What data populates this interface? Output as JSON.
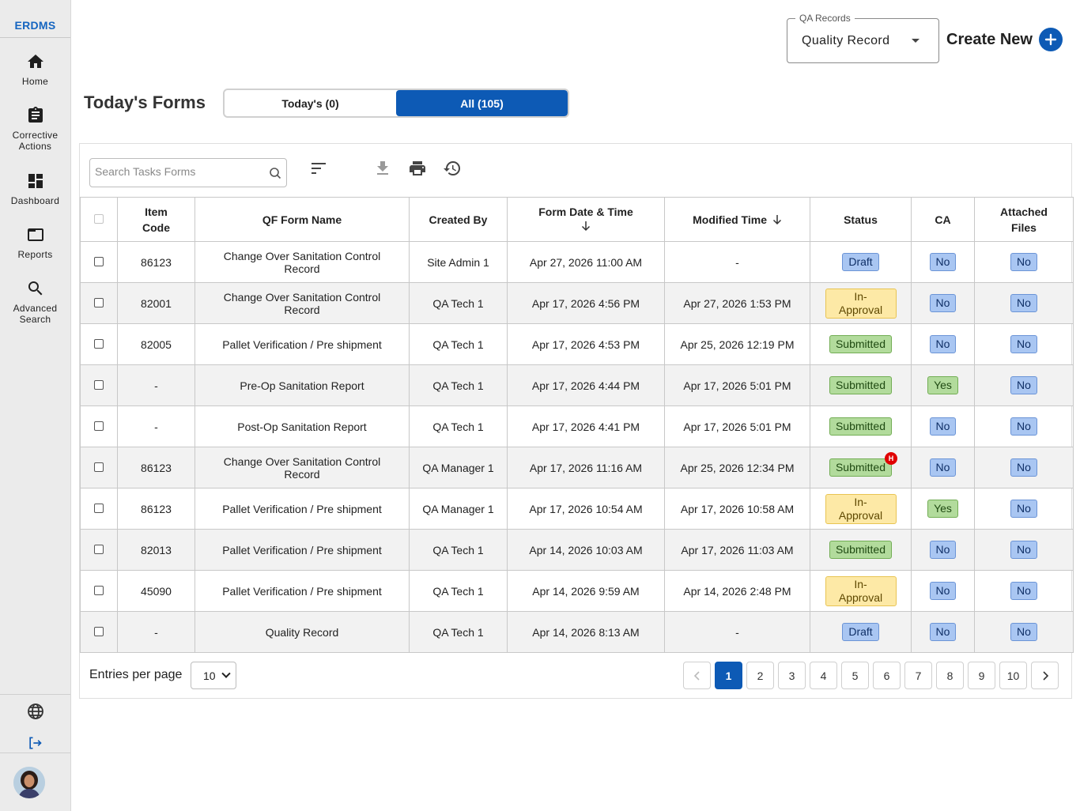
{
  "brand": "ERDMS",
  "sidebar": {
    "items": [
      {
        "label": "Home",
        "icon": "home-icon"
      },
      {
        "label": "Corrective Actions",
        "icon": "clipboard-icon"
      },
      {
        "label": "Dashboard",
        "icon": "dashboard-icon"
      },
      {
        "label": "Reports",
        "icon": "reports-icon"
      },
      {
        "label": "Advanced Search",
        "icon": "search-icon"
      }
    ],
    "bottom_icons": [
      "globe-icon",
      "logout-icon"
    ]
  },
  "header": {
    "qa_legend": "QA Records",
    "qa_value": "Quality Record",
    "create_new": "Create New"
  },
  "page_title": "Today's Forms",
  "tabs": {
    "today": "Today's (0)",
    "all": "All (105)"
  },
  "toolbar": {
    "search_placeholder": "Search Tasks Forms"
  },
  "table": {
    "columns": [
      "Item Code",
      "QF Form Name",
      "Created By",
      "Form Date & Time",
      "Modified Time",
      "Status",
      "CA",
      "Attached Files"
    ],
    "rows": [
      {
        "code": "86123",
        "name": "Change Over Sanitation Control Record",
        "by": "Site Admin 1",
        "date": "Apr 27, 2026 11:00 AM",
        "modified": "-",
        "status": "Draft",
        "ca": "No",
        "files": "No"
      },
      {
        "code": "82001",
        "name": "Change Over Sanitation Control Record",
        "by": "QA Tech 1",
        "date": "Apr 17, 2026 4:56 PM",
        "modified": "Apr 27, 2026 1:53 PM",
        "status": "In-Approval",
        "ca": "No",
        "files": "No"
      },
      {
        "code": "82005",
        "name": "Pallet Verification / Pre shipment",
        "by": "QA Tech 1",
        "date": "Apr 17, 2026 4:53 PM",
        "modified": "Apr 25, 2026 12:19 PM",
        "status": "Submitted",
        "ca": "No",
        "files": "No"
      },
      {
        "code": "-",
        "name": "Pre-Op Sanitation Report",
        "by": "QA Tech 1",
        "date": "Apr 17, 2026 4:44 PM",
        "modified": "Apr 17, 2026 5:01 PM",
        "status": "Submitted",
        "ca": "Yes",
        "files": "No"
      },
      {
        "code": "-",
        "name": "Post-Op Sanitation Report",
        "by": "QA Tech 1",
        "date": "Apr 17, 2026 4:41 PM",
        "modified": "Apr 17, 2026 5:01 PM",
        "status": "Submitted",
        "ca": "No",
        "files": "No"
      },
      {
        "code": "86123",
        "name": "Change Over Sanitation Control Record",
        "by": "QA Manager 1",
        "date": "Apr 17, 2026 11:16 AM",
        "modified": "Apr 25, 2026 12:34 PM",
        "status": "Submitted",
        "status_flag": "H",
        "ca": "No",
        "files": "No"
      },
      {
        "code": "86123",
        "name": "Pallet Verification / Pre shipment",
        "by": "QA Manager 1",
        "date": "Apr 17, 2026 10:54 AM",
        "modified": "Apr 17, 2026 10:58 AM",
        "status": "In-Approval",
        "ca": "Yes",
        "files": "No"
      },
      {
        "code": "82013",
        "name": "Pallet Verification / Pre shipment",
        "by": "QA Tech 1",
        "date": "Apr 14, 2026 10:03 AM",
        "modified": "Apr 17, 2026 11:03 AM",
        "status": "Submitted",
        "ca": "No",
        "files": "No"
      },
      {
        "code": "45090",
        "name": "Pallet Verification / Pre shipment",
        "by": "QA Tech 1",
        "date": "Apr 14, 2026 9:59 AM",
        "modified": "Apr 14, 2026 2:48 PM",
        "status": "In-Approval",
        "ca": "No",
        "files": "No"
      },
      {
        "code": "-",
        "name": "Quality Record",
        "by": "QA Tech 1",
        "date": "Apr 14, 2026 8:13 AM",
        "modified": "-",
        "status": "Draft",
        "ca": "No",
        "files": "No"
      }
    ]
  },
  "footer": {
    "entries_label": "Entries per page",
    "per_page": "10",
    "pages": [
      "1",
      "2",
      "3",
      "4",
      "5",
      "6",
      "7",
      "8",
      "9",
      "10"
    ],
    "current_page": "1"
  },
  "colors": {
    "accent": "#0d5ab5",
    "draft": "#a9c6f2",
    "submitted": "#b2db9c",
    "in_approval": "#fde9a6"
  }
}
